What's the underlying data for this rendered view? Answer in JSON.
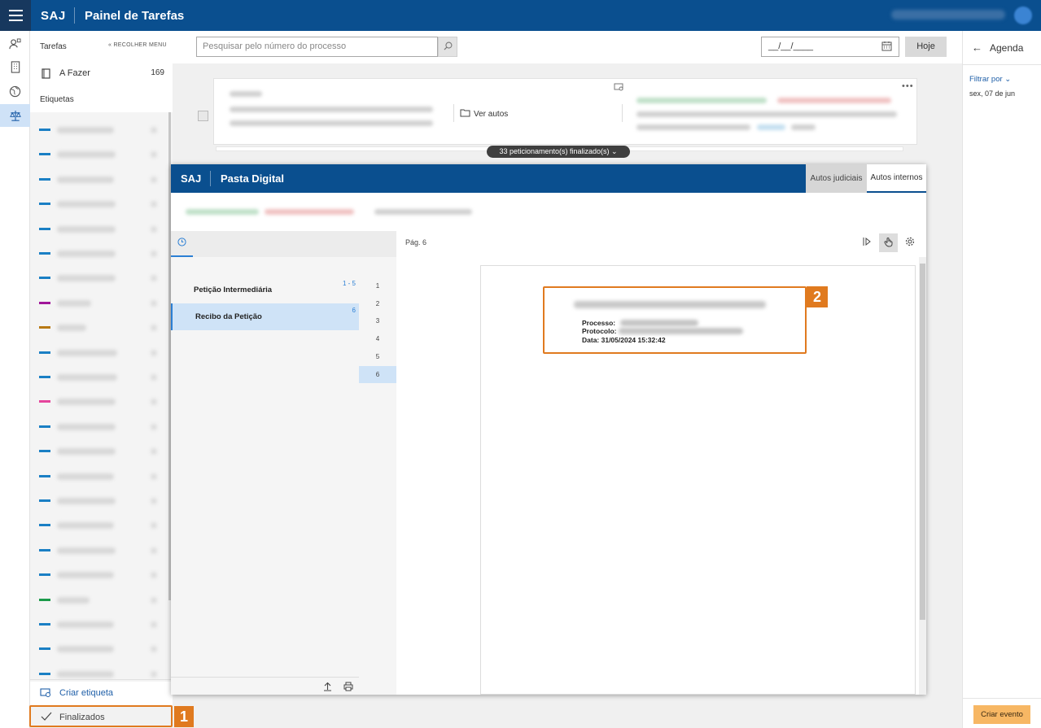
{
  "header": {
    "brand": "SAJ",
    "title": "Painel de Tarefas"
  },
  "left_panel": {
    "tasks_heading": "Tarefas",
    "collapse_label": "RECOLHER MENU",
    "todo_label": "A Fazer",
    "todo_count": "169",
    "labels_heading": "Etiquetas",
    "tag_colors": [
      "#1a7fc4",
      "#1a7fc4",
      "#1a7fc4",
      "#1a7fc4",
      "#1a7fc4",
      "#1a7fc4",
      "#1a7fc4",
      "#a0169a",
      "#b87a14",
      "#1a7fc4",
      "#1a7fc4",
      "#e5459c",
      "#1a7fc4",
      "#1a7fc4",
      "#1a7fc4",
      "#1a7fc4",
      "#1a7fc4",
      "#1a7fc4",
      "#1a7fc4",
      "#1b9a4a",
      "#1a7fc4",
      "#1a7fc4",
      "#1a7fc4"
    ],
    "create_label": "Criar etiqueta",
    "finished_label": "Finalizados"
  },
  "toolbar": {
    "search_placeholder": "Pesquisar pelo número do processo",
    "date_placeholder": "__/__/____",
    "today_label": "Hoje"
  },
  "card": {
    "view_records_label": "Ver autos",
    "more_label": "•••",
    "petitions_pill": "33 peticionamento(s) finalizado(s)"
  },
  "pasta_digital": {
    "brand": "SAJ",
    "title": "Pasta Digital",
    "tab_judicial": "Autos judiciais",
    "tab_internal": "Autos internos",
    "page_label": "Pág. 6",
    "more_label": "•••",
    "documents": [
      {
        "label": "Petição Intermediária",
        "range": "1 - 5"
      },
      {
        "label": "Recibo da Petição",
        "range": "6"
      }
    ],
    "pages": [
      "1",
      "2",
      "3",
      "4",
      "5",
      "6"
    ],
    "receipt": {
      "processo_label": "Processo:",
      "protocolo_label": "Protocolo:",
      "data_line": "Data: 31/05/2024 15:32:42"
    }
  },
  "callouts": {
    "one": "1",
    "two": "2"
  },
  "agenda": {
    "title": "Agenda",
    "filter_label": "Filtrar por",
    "date": "sex, 07 de jun",
    "create_event": "Criar evento"
  },
  "colors": {
    "header_blue": "#0a4f8f",
    "highlight_orange": "#e07a1f",
    "create_event_orange": "#f7b764"
  }
}
